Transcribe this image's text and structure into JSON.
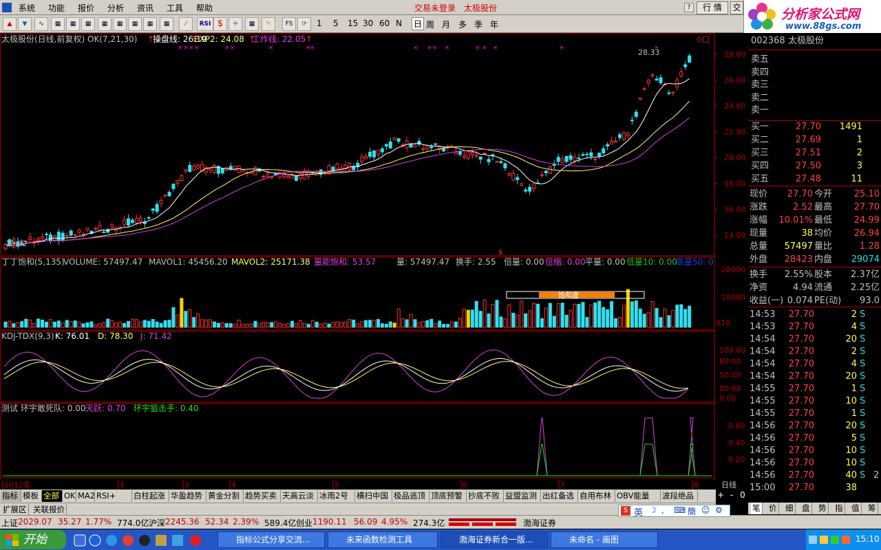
{
  "menu": [
    "系统",
    "功能",
    "报价",
    "分析",
    "资讯",
    "工具",
    "帮助"
  ],
  "trade_link": "交易未登录",
  "stock_link": "太极股份",
  "hq_btn": "行 情",
  "jy_btn": "交",
  "toolbar_icons": [
    "chart-up-icon",
    "chart-down-icon",
    "line-chart-icon",
    "grid-icon",
    "table-icon",
    "f10-icon",
    "news-icon",
    "calc-icon",
    "f10b-icon",
    "formula-icon",
    "text-icon",
    "draw-line-icon",
    "rsi-icon",
    "dollar-icon",
    "crosshair-icon",
    "zoom-icon",
    "pen-icon",
    "fs-icon",
    "refresh-icon"
  ],
  "period_nums": [
    "1",
    "5",
    "15",
    "30",
    "60",
    "N"
  ],
  "periods": [
    "日",
    "周",
    "月",
    "多",
    "季",
    "年"
  ],
  "rsi_label": "RSI",
  "fs_label": "FS",
  "logo": {
    "title": "分析家公式网",
    "url": "www.88gs.com"
  },
  "main_header": {
    "name": "太极股份(日线,前复权) OK(7,21,30)",
    "l1": "操盘线: 26.19",
    "l2": "EXP2: 24.08",
    "l3": "工作线: 22.05"
  },
  "main_axis": [
    "28.00",
    "26.00",
    "24.00",
    "22.00",
    "20.00",
    "18.00",
    "16.00",
    "14.00"
  ],
  "price_high": "28.33",
  "price_low": "13.02",
  "vol_header": {
    "t0": "丁丁饱和(5,135)",
    "t1": "VOLUME: 57497.47",
    "t2": "MAVOL1: 45456.20",
    "t3": "MAVOL2: 25171.38",
    "t4": "量能饱和: 53.57",
    "t5": "量: 57497.47",
    "t6": "换手: 2.55",
    "t7": "倍量: 0.00",
    "t8": "倍缩: 0.00",
    "t9": "平量: 0.00",
    "t10": "低量10: 0.00",
    "t11": "高量50: 0"
  },
  "vol_axis": [
    "20000",
    "10000"
  ],
  "vol_x10": "X10",
  "sat_label": "饱和度",
  "kdj_header": {
    "t0": "KDJ-TDX(9,3)",
    "t1": "K: 76.01",
    "t2": "D: 78.30",
    "t3": "J: 71.42"
  },
  "kdj_axis": [
    "100.00",
    "80.00",
    "50.00",
    "20.00",
    "0.00"
  ],
  "test_header": {
    "t0": "测试",
    "t1": "环宇敢死队: 0.00",
    "t2": "天跃: 0.70",
    "t3": "环宇狙击手: 0.40"
  },
  "test_axis": [
    "0.60",
    "0.40",
    "0.20"
  ],
  "months": [
    "2012年",
    "1",
    "3",
    "4",
    "5",
    "6",
    "7",
    "8"
  ],
  "rq": {
    "code": "002368",
    "name": "太极股份"
  },
  "sells": [
    "卖五",
    "卖四",
    "卖三",
    "卖二",
    "卖一"
  ],
  "buys": [
    {
      "l": "买一",
      "p": "27.70",
      "v": "1491"
    },
    {
      "l": "买二",
      "p": "27.69",
      "v": "1"
    },
    {
      "l": "买三",
      "p": "27.51",
      "v": "2"
    },
    {
      "l": "买四",
      "p": "27.50",
      "v": "3"
    },
    {
      "l": "买五",
      "p": "27.48",
      "v": "11"
    }
  ],
  "stats": [
    {
      "a": "现价",
      "b": "27.70",
      "c": "今开",
      "d": "25.10"
    },
    {
      "a": "涨跌",
      "b": "2.52",
      "c": "最高",
      "d": "27.70"
    },
    {
      "a": "涨幅",
      "b": "10.01%",
      "c": "最低",
      "d": "24.99"
    },
    {
      "a": "现量",
      "b": "38",
      "c": "均价",
      "d": "26.94"
    },
    {
      "a": "总量",
      "b": "57497",
      "c": "量比",
      "d": "1.28"
    },
    {
      "a": "外盘",
      "b": "28423",
      "c": "内盘",
      "d": "29074"
    },
    {
      "a": "换手",
      "b": "2.55%",
      "c": "股本",
      "d": "2.37亿"
    },
    {
      "a": "净资",
      "b": "4.94",
      "c": "流通",
      "d": "2.25亿"
    },
    {
      "a": "收益(一)",
      "b": "0.074",
      "c": "PE(动)",
      "d": "93.0"
    }
  ],
  "ticks": [
    {
      "t": "14:53",
      "p": "27.70",
      "v": "2",
      "s": "S"
    },
    {
      "t": "14:53",
      "p": "27.70",
      "v": "4",
      "s": "S"
    },
    {
      "t": "14:54",
      "p": "27.70",
      "v": "20",
      "s": "S"
    },
    {
      "t": "14:54",
      "p": "27.70",
      "v": "2",
      "s": "S"
    },
    {
      "t": "14:54",
      "p": "27.70",
      "v": "4",
      "s": "S"
    },
    {
      "t": "14:54",
      "p": "27.70",
      "v": "20",
      "s": "S"
    },
    {
      "t": "14:55",
      "p": "27.70",
      "v": "1",
      "s": "S"
    },
    {
      "t": "14:55",
      "p": "27.70",
      "v": "10",
      "s": "S"
    },
    {
      "t": "14:55",
      "p": "27.70",
      "v": "1",
      "s": "S"
    },
    {
      "t": "14:56",
      "p": "27.70",
      "v": "20",
      "s": "S"
    },
    {
      "t": "14:56",
      "p": "27.70",
      "v": "5",
      "s": "S"
    },
    {
      "t": "14:56",
      "p": "27.70",
      "v": "10",
      "s": "S"
    },
    {
      "t": "14:56",
      "p": "27.70",
      "v": "10",
      "s": "S"
    },
    {
      "t": "14:56",
      "p": "27.70",
      "v": "40",
      "s": "S"
    },
    {
      "t": "15:00",
      "p": "27.70",
      "v": "38",
      "s": ""
    }
  ],
  "tick_extra": "2",
  "rp_tabs": [
    "笔",
    "价",
    "细",
    "盘",
    "势",
    "指",
    "值",
    "筹"
  ],
  "day_label": "日线",
  "bottom_tabs": [
    "指标",
    "模板",
    "全部",
    "OK",
    "MA2",
    "RSI+",
    "白柱起涨",
    "华盈趋势",
    "黄金分割",
    "趋势买卖",
    "天高云淡",
    "冰雨2号",
    "横扫中国",
    "极品逃顶",
    "顶底预警",
    "抄底不败",
    "益盟监测",
    "出红备选",
    "自用布林",
    "OBV能量",
    "波段绝品"
  ],
  "bottom_ctrl": [
    "+",
    "-",
    "0"
  ],
  "tabs2": [
    "扩展区",
    "关联报价"
  ],
  "ime": "英",
  "status": {
    "sh_l": "上证",
    "sh": "2029.07",
    "sh_c": "35.27",
    "sh_p": "1.77%",
    "sh_a": "774.0亿",
    "sz_l": "沪深",
    "sz": "2245.36",
    "sz_c": "52.34",
    "sz_p": "2.39%",
    "sz_a": "589.4亿",
    "cy_l": "创业",
    "cy": "1190.11",
    "cy_c": "56.09",
    "cy_p": "4.95%",
    "cy_a": "274.3亿",
    "broker": "渤海证券"
  },
  "start": "开始",
  "tasks": [
    "指标公式分享交流...",
    "未来函数检测工具",
    "渤海证券新合一版...",
    "未命名 - 画图"
  ],
  "clock": "15:10"
}
